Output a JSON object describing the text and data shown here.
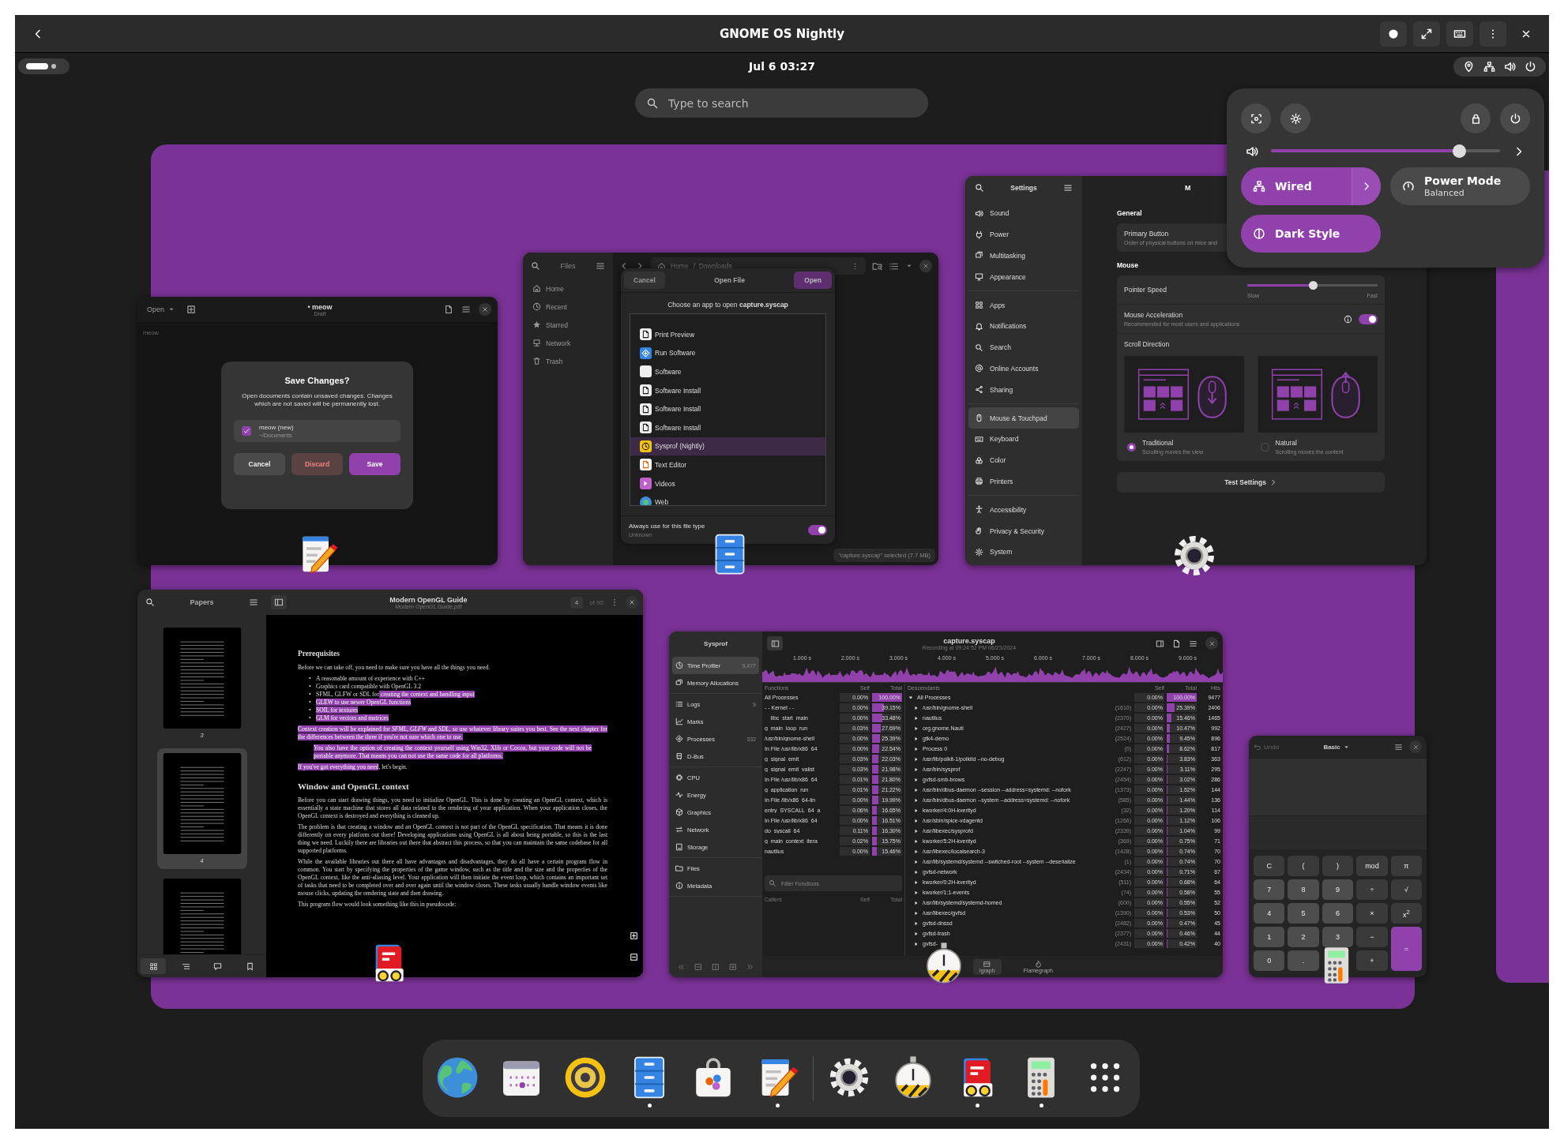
{
  "viewer": {
    "title": "GNOME OS Nightly"
  },
  "top_bar": {
    "clock": "Jul 6  03:27"
  },
  "search": {
    "placeholder": "Type to search"
  },
  "quick_settings": {
    "volume": {
      "level": 0.82
    },
    "toggles": [
      {
        "label": "Wired",
        "kind": "menu",
        "on": true
      },
      {
        "label": "Power Mode",
        "sublabel": "Balanced",
        "kind": "toggle",
        "on": false
      },
      {
        "label": "Dark Style",
        "kind": "toggle",
        "on": true
      }
    ]
  },
  "text_editor": {
    "open_label": "Open",
    "title": "• meow",
    "subtitle": "Draft",
    "body": "meow",
    "dialog": {
      "title": "Save Changes?",
      "message": "Open documents contain unsaved changes. Changes which are not saved will be permanently lost.",
      "documents": [
        {
          "name": "meow (new)",
          "path": "~/Documents",
          "checked": true
        }
      ],
      "buttons": [
        {
          "label": "Cancel",
          "kind": "normal"
        },
        {
          "label": "Discard",
          "kind": "destructive"
        },
        {
          "label": "Save",
          "kind": "suggested"
        }
      ]
    }
  },
  "files": {
    "title": "Files",
    "sidebar": [
      {
        "label": "Home"
      },
      {
        "label": "Recent"
      },
      {
        "label": "Starred"
      },
      {
        "label": "Network"
      },
      {
        "label": "Trash"
      }
    ],
    "path": [
      "Home",
      "Downloads"
    ],
    "status": "\"capture.syscap\" selected  (7.7 MB)",
    "dialog": {
      "cancel": "Cancel",
      "title": "Open File",
      "open": "Open",
      "prompt": "Choose an app to open **capture.syscap**",
      "apps": [
        {
          "name": "Print Preview",
          "selected": false
        },
        {
          "name": "Run Software",
          "selected": false
        },
        {
          "name": "Software",
          "selected": false
        },
        {
          "name": "Software Install",
          "selected": false
        },
        {
          "name": "Software Install",
          "selected": false
        },
        {
          "name": "Software Install",
          "selected": false
        },
        {
          "name": "Sysprof (Nightly)",
          "selected": true
        },
        {
          "name": "Text Editor",
          "selected": false
        },
        {
          "name": "Videos",
          "selected": false
        },
        {
          "name": "Web",
          "selected": false
        }
      ],
      "always": {
        "label": "Always use for this file type",
        "sublabel": "Unknown",
        "on": true
      }
    }
  },
  "settings": {
    "title": "Settings",
    "header_title": "M",
    "sidebar": [
      [
        {
          "label": "Sound",
          "selected": false
        },
        {
          "label": "Power",
          "selected": false
        },
        {
          "label": "Multitasking",
          "selected": false
        },
        {
          "label": "Appearance",
          "selected": false
        }
      ],
      [
        {
          "label": "Apps",
          "selected": false
        },
        {
          "label": "Notifications",
          "selected": false
        },
        {
          "label": "Search",
          "selected": false
        },
        {
          "label": "Online Accounts",
          "selected": false
        },
        {
          "label": "Sharing",
          "selected": false
        }
      ],
      [
        {
          "label": "Mouse & Touchpad",
          "selected": true
        },
        {
          "label": "Keyboard",
          "selected": false
        },
        {
          "label": "Color",
          "selected": false
        },
        {
          "label": "Printers",
          "selected": false
        }
      ],
      [
        {
          "label": "Accessibility",
          "selected": false
        },
        {
          "label": "Privacy & Security",
          "selected": false
        },
        {
          "label": "System",
          "selected": false
        }
      ]
    ],
    "general_heading": "General",
    "primary_button": {
      "title": "Primary Button",
      "subtitle": "Order of physical buttons on mice and"
    },
    "mouse_heading": "Mouse",
    "pointer_speed": {
      "label": "Pointer Speed",
      "level": 0.5,
      "min": "Slow",
      "max": "Fast"
    },
    "acceleration": {
      "title": "Mouse Acceleration",
      "subtitle": "Recommended for most users and applications",
      "on": true
    },
    "scroll": {
      "label": "Scroll Direction",
      "options": [
        {
          "title": "Traditional",
          "subtitle": "Scrolling moves the view",
          "selected": true
        },
        {
          "title": "Natural",
          "subtitle": "Scrolling moves the content",
          "selected": false
        }
      ]
    },
    "test_button": "Test Settings"
  },
  "papers": {
    "sidebar_title": "Papers",
    "doc_title": "Modern OpenGL Guide",
    "doc_file": "Modern OpenGL Guide.pdf",
    "page": "4",
    "page_total": "of 90",
    "thumbnails": [
      {
        "label": "3",
        "selected": false
      },
      {
        "label": "4",
        "selected": true
      },
      {
        "selected": false
      }
    ],
    "blocks": [
      {
        "kind": "heading",
        "segments": [
          {
            "text": "Prerequisites",
            "highlighted": false
          }
        ]
      },
      {
        "kind": "paragraph",
        "segments": [
          {
            "text": "Before we can take off, you need to make sure you have all the things you need.",
            "highlighted": false
          }
        ]
      },
      {
        "kind": "list",
        "items": [
          {
            "bullet": "•",
            "segments": [
              {
                "text": "A reasonable amount of experience with C++",
                "highlighted": false
              }
            ]
          },
          {
            "bullet": "•",
            "segments": [
              {
                "text": "Graphics card compatible with OpenGL 3.2",
                "highlighted": false
              }
            ]
          },
          {
            "bullet": "•",
            "segments": [
              {
                "text": "SFML, GLFW or SDL for",
                "highlighted": false
              },
              {
                "text": " creating the context and handling input",
                "highlighted": true
              }
            ]
          },
          {
            "bullet": "•",
            "segments": [
              {
                "text": "GLEW to use newer OpenGL functions",
                "highlighted": true
              }
            ]
          },
          {
            "bullet": "•",
            "segments": [
              {
                "text": "SOIL for textures",
                "highlighted": true
              }
            ]
          },
          {
            "bullet": "•",
            "segments": [
              {
                "text": "GLM for vectors and matrices",
                "highlighted": true
              }
            ]
          }
        ]
      },
      {
        "kind": "paragraph",
        "segments": [
          {
            "text": "Context creation will be explained for *SFML*, *GLFW* and *SDL*, so use whatever library suites you best. See the next chapter for the differences between the three if you're not sure which one to use.",
            "highlighted": true
          }
        ]
      },
      {
        "kind": "quote",
        "segments": [
          {
            "text": "You also have the option of creating the context yourself using Win32, Xlib or Cocoa, but your code will not be portable anymore. That means you can not use the same code for all platforms.",
            "highlighted": true
          }
        ]
      },
      {
        "kind": "paragraph",
        "segments": [
          {
            "text": "If you've got everything you need",
            "highlighted": true
          },
          {
            "text": ", let's begin.",
            "highlighted": false
          }
        ]
      },
      {
        "kind": "heading",
        "segments": [
          {
            "text": "Window and OpenGL context",
            "highlighted": false
          }
        ]
      },
      {
        "kind": "paragraph",
        "segments": [
          {
            "text": "Before you can start drawing things, you need to initialize OpenGL. This is done by creating an OpenGL context, which is essentially a state machine that stores all data related to the rendering of your application. When your application closes, the OpenGL context is destroyed and everything is cleaned up.",
            "highlighted": false
          }
        ]
      },
      {
        "kind": "paragraph",
        "segments": [
          {
            "text": "The problem is that creating a window and an OpenGL context is not part of the OpenGL specification. That means it is done differently on every platform out there! Developing applications using OpenGL is all about being portable, so this is the last thing we need. Luckily there are libraries out there that abstract this process, so that you can maintain the same codebase for all supported platforms.",
            "highlighted": false
          }
        ]
      },
      {
        "kind": "paragraph",
        "segments": [
          {
            "text": "While the available libraries out there all have advantages and disadvantages, they do all have a certain program flow in common. You start by specifying the properties of the game window, such as the title and the size and the properties of the OpenGL context, like the anti-aliasing level. Your application will then initiate the event loop, which contains an important set of tasks that need to be completed over and over again until the window closes. These tasks usually handle window events like mouse clicks, updating the rendering state and then drawing.",
            "highlighted": false
          }
        ]
      },
      {
        "kind": "paragraph",
        "segments": [
          {
            "text": "This program flow would look something like this in pseudocode:",
            "highlighted": false
          }
        ]
      }
    ]
  },
  "sysprof": {
    "app_title": "Sysprof",
    "title": "capture.syscap",
    "subtitle": "Recording at 09:24:52 PM 06/23/2024",
    "sidebar": [
      [
        {
          "label": "Time Profiler",
          "count": "9,477",
          "selected": true
        },
        {
          "label": "Memory Allocations",
          "selected": false
        }
      ],
      [
        {
          "label": "Logs",
          "count": "9",
          "selected": false
        },
        {
          "label": "Marks",
          "selected": false
        },
        {
          "label": "Processes",
          "count": "332",
          "selected": false
        },
        {
          "label": "D-Bus",
          "selected": false
        }
      ],
      [
        {
          "label": "CPU",
          "selected": false
        },
        {
          "label": "Energy",
          "selected": false
        },
        {
          "label": "Graphics",
          "selected": false
        },
        {
          "label": "Network",
          "selected": false
        },
        {
          "label": "Storage",
          "selected": false
        }
      ],
      [
        {
          "label": "Files",
          "selected": false
        },
        {
          "label": "Metadata",
          "selected": false
        }
      ]
    ],
    "ticks": [
      "1.000 s",
      "2.000 s",
      "3.000 s",
      "4.000 s",
      "5.000 s",
      "6.000 s",
      "7.000 s",
      "8.000 s",
      "9.000 s"
    ],
    "functions": {
      "columns": [
        "Functions",
        "Self",
        "Total"
      ],
      "rows": [
        {
          "name": "All Processes",
          "self": "0.00%",
          "total": "100.00%",
          "level": 1.0
        },
        {
          "name": "- - Kernel - -",
          "self": "0.00%",
          "total": "39.15%",
          "level": 0.3915
        },
        {
          "name": "__libc_start_main",
          "self": "0.00%",
          "total": "33.48%",
          "level": 0.3348
        },
        {
          "name": "g_main_loop_run",
          "self": "0.03%",
          "total": "27.69%",
          "level": 0.2769
        },
        {
          "name": "/usr/bin/gnome-shell",
          "self": "0.00%",
          "total": "25.39%",
          "level": 0.2539
        },
        {
          "name": "In File /usr/lib/x86_64",
          "self": "0.00%",
          "total": "22.54%",
          "level": 0.2254
        },
        {
          "name": "g_signal_emit",
          "self": "0.03%",
          "total": "22.03%",
          "level": 0.2203
        },
        {
          "name": "g_signal_emit_valist",
          "self": "0.03%",
          "total": "21.98%",
          "level": 0.2198
        },
        {
          "name": "In File /usr/lib/x86_64",
          "self": "0.01%",
          "total": "21.80%",
          "level": 0.218
        },
        {
          "name": "g_application_run",
          "self": "0.01%",
          "total": "21.22%",
          "level": 0.2122
        },
        {
          "name": "In File /lib/x86_64-lin",
          "self": "0.00%",
          "total": "19.99%",
          "level": 0.1999
        },
        {
          "name": "entry_SYSCALL_64_a",
          "self": "0.06%",
          "total": "16.65%",
          "level": 0.1665
        },
        {
          "name": "In File /usr/lib/x86_64",
          "self": "0.00%",
          "total": "16.51%",
          "level": 0.1651
        },
        {
          "name": "do_syscall_64",
          "self": "0.11%",
          "total": "16.30%",
          "level": 0.163
        },
        {
          "name": "g_main_context_itera",
          "self": "0.02%",
          "total": "15.75%",
          "level": 0.1575
        },
        {
          "name": "nautilus",
          "self": "0.00%",
          "total": "15.46%",
          "level": 0.1546
        }
      ]
    },
    "filter_placeholder": "Filter Functions",
    "callers": {
      "columns": [
        "Callers",
        "Self",
        "Total"
      ]
    },
    "descendants": {
      "columns": [
        "Descendants",
        "Self",
        "Total",
        "Hits"
      ],
      "rows": [
        {
          "name": "All Processes",
          "self": "0.00%",
          "total": "100.00%",
          "level": 1.0,
          "hits": "9477",
          "expanded": true
        },
        {
          "name": "/usr/bin/gnome-shell",
          "pid": "(1610)",
          "self": "0.00%",
          "total": "25.39%",
          "level": 0.2539,
          "hits": "2406",
          "expanded": false
        },
        {
          "name": "nautilus",
          "pid": "(2370)",
          "self": "0.00%",
          "total": "15.46%",
          "level": 0.1546,
          "hits": "1465",
          "expanded": false
        },
        {
          "name": "org.gnome.Nauti",
          "pid": "(2427)",
          "self": "0.00%",
          "total": "10.47%",
          "level": 0.1047,
          "hits": "992",
          "expanded": false
        },
        {
          "name": "gtk4-demo",
          "pid": "(2524)",
          "self": "0.00%",
          "total": "9.45%",
          "level": 0.0945,
          "hits": "896",
          "expanded": false
        },
        {
          "name": "Process 0",
          "pid": "(0)",
          "self": "0.00%",
          "total": "8.62%",
          "level": 0.0862,
          "hits": "817",
          "expanded": false
        },
        {
          "name": "/usr/lib/polkit-1/polkitd --no-debug",
          "pid": "(612)",
          "self": "0.00%",
          "total": "3.83%",
          "level": 0.0383,
          "hits": "363",
          "expanded": false
        },
        {
          "name": "/usr/bin/sysprof",
          "pid": "(2247)",
          "self": "0.00%",
          "total": "3.11%",
          "level": 0.0311,
          "hits": "295",
          "expanded": false
        },
        {
          "name": "gvfsd-smb-brows",
          "pid": "(2454)",
          "self": "0.00%",
          "total": "3.02%",
          "level": 0.0302,
          "hits": "286",
          "expanded": false
        },
        {
          "name": "/usr/bin/dbus-daemon --session --address=systemd: --nofork",
          "pid": "(1373)",
          "self": "0.00%",
          "total": "1.52%",
          "level": 0.0152,
          "hits": "144",
          "expanded": false
        },
        {
          "name": "/usr/bin/dbus-daemon --system --address=systemd: --nofork",
          "pid": "(585)",
          "self": "0.00%",
          "total": "1.44%",
          "level": 0.0144,
          "hits": "136",
          "expanded": false
        },
        {
          "name": "kworker/4:0H-kverityd",
          "pid": "(32)",
          "self": "0.00%",
          "total": "1.20%",
          "level": 0.012,
          "hits": "114",
          "expanded": false
        },
        {
          "name": "/usr/sbin/spice-vdagentd",
          "pid": "(1266)",
          "self": "0.00%",
          "total": "1.12%",
          "level": 0.0112,
          "hits": "106",
          "expanded": false
        },
        {
          "name": "/usr/libexec/sysprofd",
          "pid": "(2339)",
          "self": "0.00%",
          "total": "1.04%",
          "level": 0.0104,
          "hits": "99",
          "expanded": false
        },
        {
          "name": "kworker/5:2H-kverityd",
          "pid": "(369)",
          "self": "0.00%",
          "total": "0.75%",
          "level": 0.0075,
          "hits": "71",
          "expanded": false
        },
        {
          "name": "/usr/libexec/localsearch-3",
          "pid": "(1428)",
          "self": "0.00%",
          "total": "0.74%",
          "level": 0.0074,
          "hits": "70",
          "expanded": false
        },
        {
          "name": "/usr/lib/systemd/systemd --switched-root --system --deserialize",
          "pid": "(1)",
          "self": "0.00%",
          "total": "0.74%",
          "level": 0.0074,
          "hits": "70",
          "expanded": false
        },
        {
          "name": "gvfsd-network",
          "pid": "(2434)",
          "self": "0.00%",
          "total": "0.71%",
          "level": 0.0071,
          "hits": "67",
          "expanded": false
        },
        {
          "name": "kworker/0:2H-kverityd",
          "pid": "(511)",
          "self": "0.00%",
          "total": "0.68%",
          "level": 0.0068,
          "hits": "64",
          "expanded": false
        },
        {
          "name": "kworker/1:1-events",
          "pid": "(74)",
          "self": "0.00%",
          "total": "0.58%",
          "level": 0.0058,
          "hits": "55",
          "expanded": false
        },
        {
          "name": "/usr/lib/systemd/systemd-homed",
          "pid": "(600)",
          "self": "0.00%",
          "total": "0.55%",
          "level": 0.0055,
          "hits": "52",
          "expanded": false
        },
        {
          "name": "/usr/libexec/gvfsd",
          "pid": "(1390)",
          "self": "0.00%",
          "total": "0.53%",
          "level": 0.0053,
          "hits": "50",
          "expanded": false
        },
        {
          "name": "gvfsd-dnssd",
          "pid": "(2482)",
          "self": "0.00%",
          "total": "0.47%",
          "level": 0.0047,
          "hits": "45",
          "expanded": false
        },
        {
          "name": "gvfsd-trash",
          "pid": "(2377)",
          "self": "0.00%",
          "total": "0.46%",
          "level": 0.0046,
          "hits": "44",
          "expanded": false
        },
        {
          "name": "gvfsd-",
          "pid": "(2431)",
          "self": "0.00%",
          "total": "0.42%",
          "level": 0.0042,
          "hits": "40",
          "expanded": false
        }
      ]
    },
    "views": [
      {
        "label": "lgraph",
        "selected": true
      },
      {
        "label": "Flamegraph",
        "selected": false
      }
    ]
  },
  "calculator": {
    "undo": "Undo",
    "mode": "Basic",
    "keys": [
      {
        "label": "C",
        "kind": "function"
      },
      {
        "label": "(",
        "kind": "function"
      },
      {
        "label": ")",
        "kind": "function"
      },
      {
        "label": "mod",
        "kind": "function"
      },
      {
        "label": "π",
        "kind": "function"
      },
      {
        "label": "7",
        "kind": "number"
      },
      {
        "label": "8",
        "kind": "number"
      },
      {
        "label": "9",
        "kind": "number"
      },
      {
        "label": "÷",
        "kind": "function"
      },
      {
        "label": "√",
        "kind": "function"
      },
      {
        "label": "4",
        "kind": "number"
      },
      {
        "label": "5",
        "kind": "number"
      },
      {
        "label": "6",
        "kind": "number"
      },
      {
        "label": "×",
        "kind": "function"
      },
      {
        "label": "x$^{2}$",
        "kind": "function"
      },
      {
        "label": "1",
        "kind": "number"
      },
      {
        "label": "2",
        "kind": "number"
      },
      {
        "label": "3",
        "kind": "number"
      },
      {
        "label": "−",
        "kind": "function"
      },
      {
        "label": "=",
        "kind": "equals"
      },
      {
        "label": "0",
        "kind": "number"
      },
      {
        "label": ".",
        "kind": "number"
      },
      {
        "label": "+",
        "kind": "function"
      }
    ]
  },
  "dock": [
    {
      "running": false
    },
    {
      "running": false
    },
    {
      "running": false
    },
    {
      "running": true
    },
    {
      "running": false
    },
    {
      "running": true
    },
    {
      "running": false
    },
    {
      "running": false
    },
    {
      "running": true
    },
    {
      "running": true
    },
    {
      "running": false
    }
  ]
}
